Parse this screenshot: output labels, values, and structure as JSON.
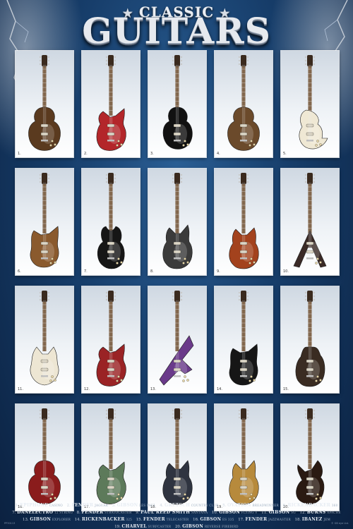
{
  "title": {
    "small": "CLASSIC",
    "big": "GUITARS",
    "star": "★"
  },
  "colors": {
    "background": "#173e6b",
    "title": "#e6e9ee"
  },
  "guitars": [
    {
      "num": "1.",
      "brand": "EPIPHONE",
      "model": "CASINO",
      "body": "#5a3a1f",
      "shape": "semi"
    },
    {
      "num": "2.",
      "brand": "FENDER",
      "model": "JAGUAR",
      "body": "#b3262a",
      "shape": "offset"
    },
    {
      "num": "3.",
      "brand": "GIBSON",
      "model": "LES PAUL",
      "body": "#111111",
      "shape": "lespaul"
    },
    {
      "num": "4.",
      "brand": "GRETSCH",
      "model": "COUNTRY CLUB",
      "body": "#6b4a2b",
      "shape": "semi"
    },
    {
      "num": "5.",
      "brand": "OVATION",
      "model": "BREADWINNER",
      "body": "#efe8d4",
      "shape": "axe"
    },
    {
      "num": "6.",
      "brand": "RICKENBACKER",
      "model": "360",
      "body": "#8a5a2e",
      "shape": "rick"
    },
    {
      "num": "7.",
      "brand": "DANELECTRO",
      "model": "12 STRING",
      "body": "#161616",
      "shape": "dano"
    },
    {
      "num": "8.",
      "brand": "FENDER",
      "model": "STRATOCASTER",
      "body": "#3b3b3b",
      "shape": "strat"
    },
    {
      "num": "9.",
      "brand": "PAUL REED SMITH",
      "model": "SANTANA",
      "body": "#a3421d",
      "shape": "prs"
    },
    {
      "num": "10.",
      "brand": "GIBSON",
      "model": "FLYING V",
      "body": "#3a2a26",
      "shape": "vee"
    },
    {
      "num": "11.",
      "brand": "GIBSON",
      "model": "SG",
      "body": "#ede6d3",
      "shape": "sg"
    },
    {
      "num": "12.",
      "brand": "BURNS",
      "model": "APACHE",
      "body": "#9a2325",
      "shape": "offset"
    },
    {
      "num": "13.",
      "brand": "GIBSON",
      "model": "EXPLORER",
      "body": "#6a3a8a",
      "shape": "explorer"
    },
    {
      "num": "14.",
      "brand": "RICKENBACKER",
      "model": "325",
      "body": "#161616",
      "shape": "rick"
    },
    {
      "num": "15.",
      "brand": "FENDER",
      "model": "TELECASTER",
      "body": "#3a2c22",
      "shape": "tele"
    },
    {
      "num": "16.",
      "brand": "GIBSON",
      "model": "ES 335",
      "body": "#8a1c1c",
      "shape": "semi"
    },
    {
      "num": "17.",
      "brand": "FENDER",
      "model": "JAZZMASTER",
      "body": "#5d7a5a",
      "shape": "offset"
    },
    {
      "num": "18.",
      "brand": "IBANEZ",
      "model": "JEM",
      "body": "#2f3440",
      "shape": "strat"
    },
    {
      "num": "19.",
      "brand": "CHARVEL",
      "model": "SURFCASTER",
      "body": "#b78a3c",
      "shape": "strat"
    },
    {
      "num": "20.",
      "brand": "GIBSON",
      "model": "REVERSE FIREBIRD",
      "body": "#2a1a12",
      "shape": "firebird"
    }
  ],
  "footer": {
    "left": "PP30113",
    "right": "© GB eye Ltd."
  }
}
